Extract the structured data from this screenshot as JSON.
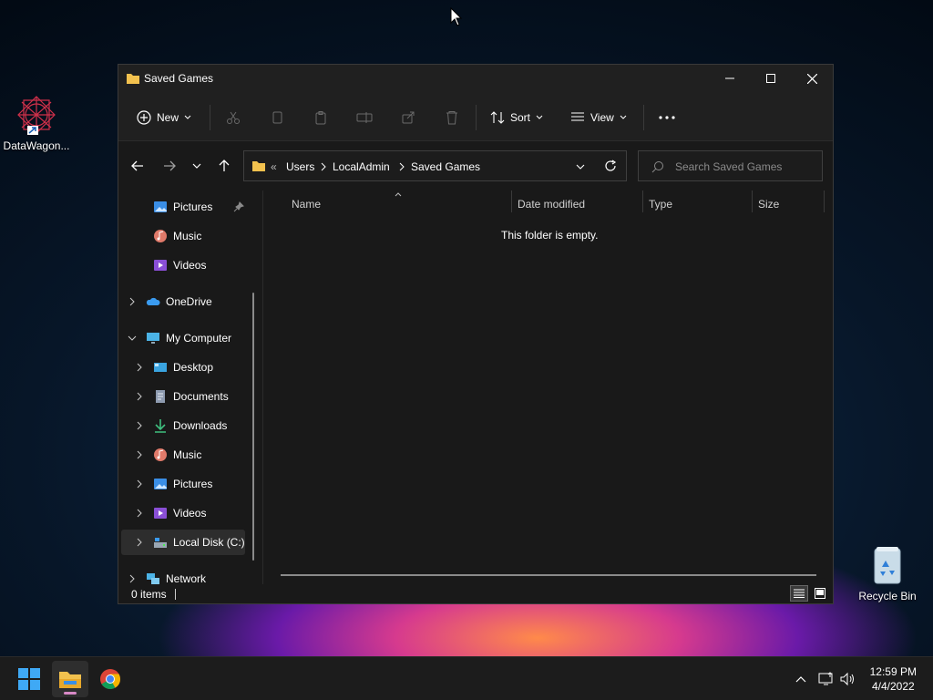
{
  "desktop": {
    "icons": [
      {
        "label": "DataWagon..."
      },
      {
        "label": "Recycle Bin"
      }
    ]
  },
  "window": {
    "title": "Saved Games",
    "toolbar": {
      "new_label": "New",
      "sort_label": "Sort",
      "view_label": "View"
    },
    "breadcrumb": {
      "overflow": "«",
      "items": [
        "Users",
        "LocalAdmin",
        "Saved Games"
      ]
    },
    "search": {
      "placeholder": "Search Saved Games"
    },
    "sidebar": {
      "items": [
        {
          "label": "Pictures",
          "icon": "pictures-icon",
          "pinned": true
        },
        {
          "label": "Music",
          "icon": "music-icon"
        },
        {
          "label": "Videos",
          "icon": "videos-icon"
        },
        {
          "label": "OneDrive",
          "icon": "onedrive-icon"
        },
        {
          "label": "My Computer",
          "icon": "computer-icon",
          "expanded": true
        },
        {
          "label": "Desktop",
          "icon": "desktop-folder-icon"
        },
        {
          "label": "Documents",
          "icon": "documents-icon"
        },
        {
          "label": "Downloads",
          "icon": "downloads-icon"
        },
        {
          "label": "Music",
          "icon": "music-icon"
        },
        {
          "label": "Pictures",
          "icon": "pictures-icon"
        },
        {
          "label": "Videos",
          "icon": "videos-icon"
        },
        {
          "label": "Local Disk (C:)",
          "icon": "drive-icon",
          "selected": true
        },
        {
          "label": "Network",
          "icon": "network-icon"
        }
      ]
    },
    "columns": [
      "Name",
      "Date modified",
      "Type",
      "Size"
    ],
    "empty_message": "This folder is empty.",
    "status": {
      "items_count": "0 items"
    }
  },
  "taskbar": {
    "apps": [
      "start-icon",
      "file-explorer-icon",
      "chrome-icon"
    ],
    "clock": {
      "time": "12:59 PM",
      "date": "4/4/2022"
    }
  },
  "colors": {
    "window_bg": "#191919",
    "titlebar_bg": "#202020",
    "accent_folder": "#f2c14e",
    "selected_bg": "#2d2d2d"
  }
}
